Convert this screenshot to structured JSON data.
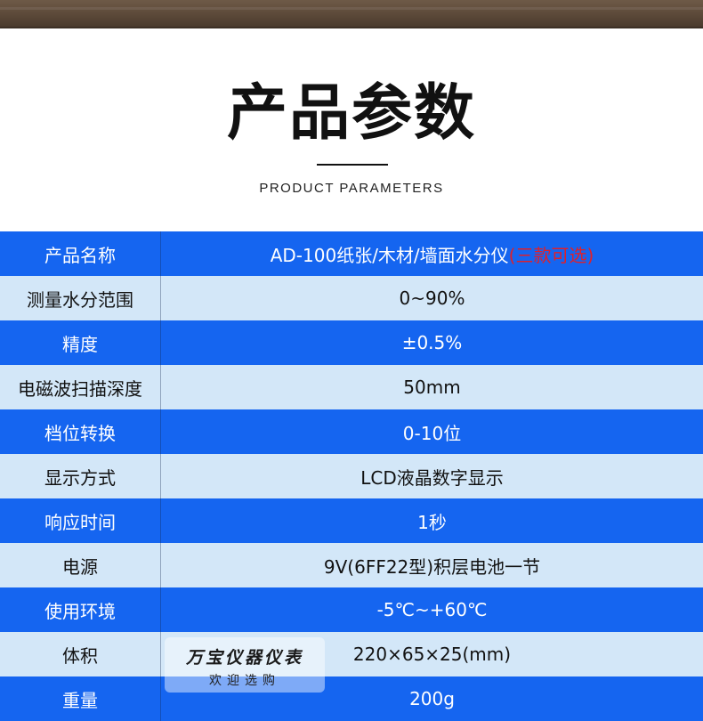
{
  "header": {
    "title": "产品参数",
    "subtitle": "PRODUCT PARAMETERS"
  },
  "colors": {
    "dark_row": "#1565f0",
    "light_row": "#d3e7f8",
    "highlight": "#e0202a"
  },
  "rows": [
    {
      "label": "产品名称",
      "value": "AD-100纸张/木材/墙面水分仪",
      "note": "(三款可选)"
    },
    {
      "label": "测量水分范围",
      "value": "0~90%"
    },
    {
      "label": "精度",
      "value": "±0.5%"
    },
    {
      "label": "电磁波扫描深度",
      "value": "50mm"
    },
    {
      "label": "档位转换",
      "value": "0-10位"
    },
    {
      "label": "显示方式",
      "value": "LCD液晶数字显示"
    },
    {
      "label": "响应时间",
      "value": "1秒"
    },
    {
      "label": "电源",
      "value": "9V(6FF22型)积层电池一节"
    },
    {
      "label": "使用环境",
      "value": "-5℃~+60℃"
    },
    {
      "label": "体积",
      "value": "220×65×25(mm)"
    },
    {
      "label": "重量",
      "value": "200g"
    }
  ],
  "watermark": {
    "title": "万宝仪器仪表",
    "subtitle": "欢迎选购"
  }
}
